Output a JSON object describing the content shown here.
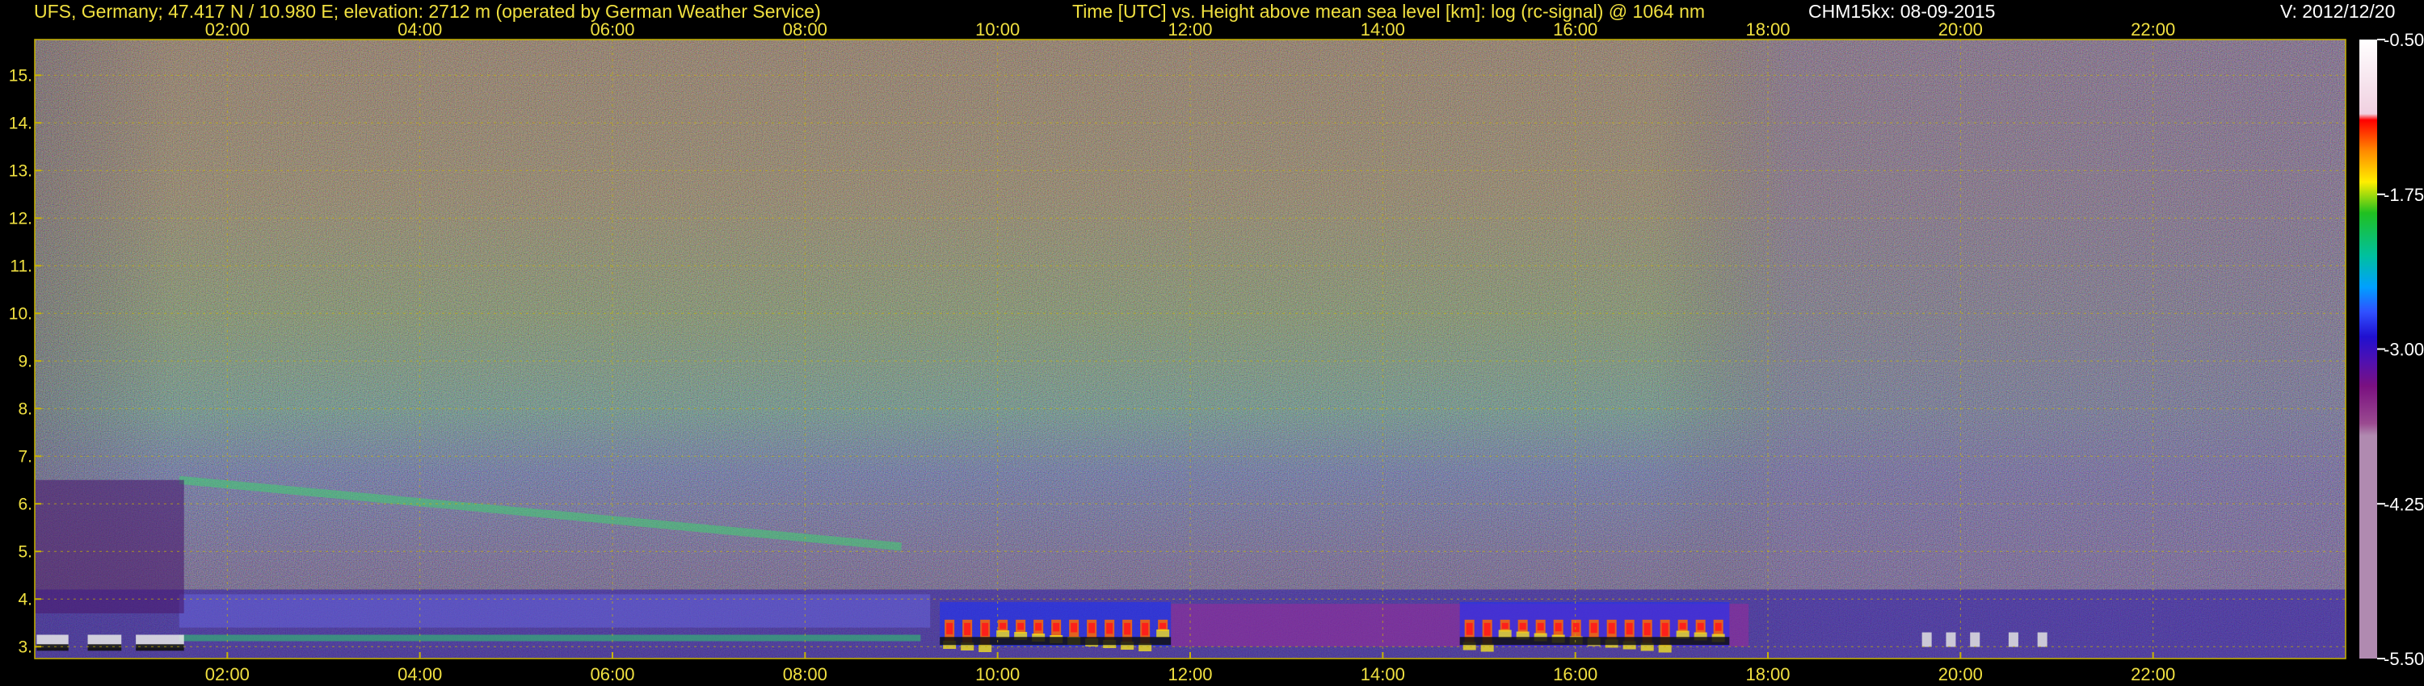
{
  "header": {
    "station": "UFS, Germany; 47.417 N / 10.980 E; elevation: 2712 m  (operated by German Weather Service)",
    "axes": "Time [UTC] vs. Height above mean sea level [km]: log (rc-signal) @ 1064 nm",
    "instrument": "CHM15kx: 08-09-2015",
    "version": "V: 2012/12/20"
  },
  "colors": {
    "header_text": "#f0e040",
    "title_white": "#ffffff",
    "grid": "#c8b400",
    "background": "#000000"
  },
  "chart_data": {
    "type": "heatmap",
    "title": "Time [UTC] vs. Height above mean sea level [km]: log (rc-signal) @ 1064 nm",
    "xlabel": "Time [UTC]",
    "ylabel": "Height above mean sea level [km]",
    "x_ticks": [
      "02:00",
      "04:00",
      "06:00",
      "08:00",
      "10:00",
      "12:00",
      "14:00",
      "16:00",
      "18:00",
      "20:00",
      "22:00"
    ],
    "x_tick_hours": [
      2,
      4,
      6,
      8,
      10,
      12,
      14,
      16,
      18,
      20,
      22
    ],
    "xlim_hours": [
      0,
      24
    ],
    "y_ticks": [
      "3.",
      "4.",
      "5.",
      "6.",
      "7.",
      "8.",
      "9.",
      "10.",
      "11.",
      "12.",
      "13.",
      "14.",
      "15."
    ],
    "y_tick_values": [
      3,
      4,
      5,
      6,
      7,
      8,
      9,
      10,
      11,
      12,
      13,
      14,
      15
    ],
    "ylim": [
      2.75,
      15.75
    ],
    "grid": true,
    "colorbar": {
      "ticks": [
        "-0.50",
        "-1.75",
        "-3.00",
        "-4.25",
        "-5.50"
      ],
      "tick_values": [
        -0.5,
        -1.75,
        -3.0,
        -4.25,
        -5.5
      ],
      "range": [
        -5.5,
        -0.5
      ]
    },
    "features": [
      {
        "name": "low cloud layer",
        "start_h": 9.4,
        "end_h": 11.8,
        "base_km": 3.0,
        "top_km": 3.6
      },
      {
        "name": "low cloud layer",
        "start_h": 14.8,
        "end_h": 17.6,
        "base_km": 3.0,
        "top_km": 3.6
      },
      {
        "name": "aerosol layer",
        "start_h": 1.5,
        "end_h": 9.0,
        "height_km": 6.3
      }
    ]
  }
}
